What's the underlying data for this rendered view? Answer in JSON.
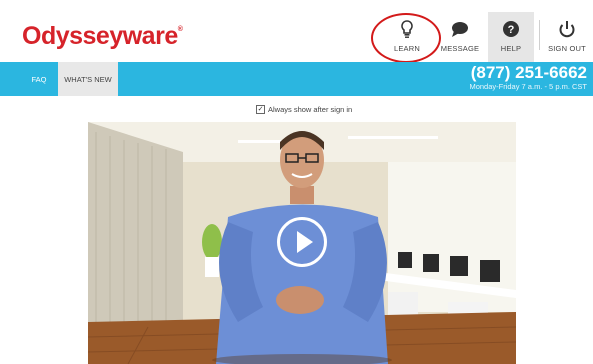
{
  "brand": {
    "name": "Odysseyware",
    "mark": "®",
    "color": "#d6232a"
  },
  "nav": {
    "learn_label": "LEARN",
    "message_label": "MESSAGE",
    "help_label": "HELP",
    "signout_label": "SIGN OUT"
  },
  "subnav": {
    "tabs": [
      "FAQ",
      "WHAT'S NEW"
    ],
    "phone": "(877) 251-6662",
    "hours": "Monday-Friday 7 a.m. - 5 p.m. CST",
    "bar_color": "#2bb6e0"
  },
  "main": {
    "always_show_label": "Always show after sign in",
    "always_show_checked": true
  },
  "annotation": {
    "color": "#d31a1a"
  }
}
